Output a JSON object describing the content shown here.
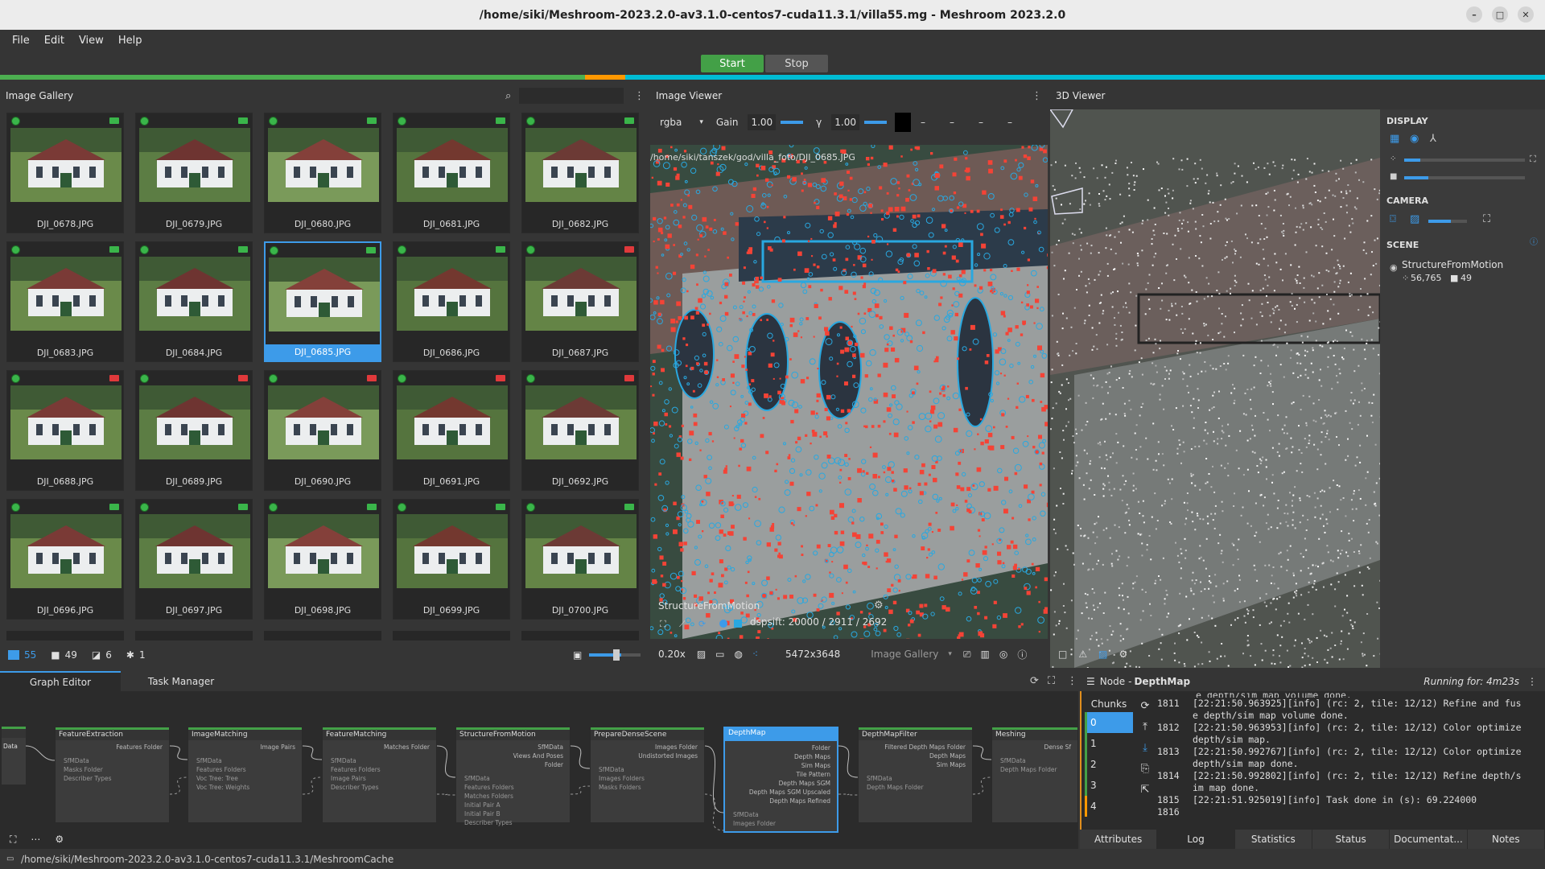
{
  "window": {
    "title": "/home/siki/Meshroom-2023.2.0-av3.1.0-centos7-cuda11.3.1/villa55.mg - Meshroom 2023.2.0"
  },
  "menu": [
    "File",
    "Edit",
    "View",
    "Help"
  ],
  "toolbar": {
    "start_label": "Start",
    "stop_label": "Stop"
  },
  "colors": {
    "accent": "#3d9be9",
    "start": "#43a047",
    "progress_green": "#4caf50",
    "progress_orange": "#ff9800",
    "progress_cyan": "#00bcd4",
    "features_red": "#f44336",
    "features_blue": "#29a8e0"
  },
  "gallery": {
    "title": "Image Gallery",
    "search_placeholder": "",
    "images": [
      {
        "name": "DJI_0678.JPG",
        "status": "ok",
        "cam": "green"
      },
      {
        "name": "DJI_0679.JPG",
        "status": "ok",
        "cam": "green"
      },
      {
        "name": "DJI_0680.JPG",
        "status": "ok",
        "cam": "green"
      },
      {
        "name": "DJI_0681.JPG",
        "status": "ok",
        "cam": "green"
      },
      {
        "name": "DJI_0682.JPG",
        "status": "ok",
        "cam": "green"
      },
      {
        "name": "DJI_0683.JPG",
        "status": "ok",
        "cam": "green"
      },
      {
        "name": "DJI_0684.JPG",
        "status": "ok",
        "cam": "green"
      },
      {
        "name": "DJI_0685.JPG",
        "status": "ok",
        "cam": "green",
        "selected": true
      },
      {
        "name": "DJI_0686.JPG",
        "status": "ok",
        "cam": "green"
      },
      {
        "name": "DJI_0687.JPG",
        "status": "ok",
        "cam": "red"
      },
      {
        "name": "DJI_0688.JPG",
        "status": "ok",
        "cam": "red"
      },
      {
        "name": "DJI_0689.JPG",
        "status": "ok",
        "cam": "red"
      },
      {
        "name": "DJI_0690.JPG",
        "status": "ok",
        "cam": "red"
      },
      {
        "name": "DJI_0691.JPG",
        "status": "ok",
        "cam": "red"
      },
      {
        "name": "DJI_0692.JPG",
        "status": "ok",
        "cam": "red"
      },
      {
        "name": "DJI_0696.JPG",
        "status": "ok",
        "cam": "green"
      },
      {
        "name": "DJI_0697.JPG",
        "status": "ok",
        "cam": "green"
      },
      {
        "name": "DJI_0698.JPG",
        "status": "ok",
        "cam": "green"
      },
      {
        "name": "DJI_0699.JPG",
        "status": "ok",
        "cam": "green"
      },
      {
        "name": "DJI_0700.JPG",
        "status": "ok",
        "cam": "green"
      }
    ],
    "footer": {
      "images": "55",
      "cameras": "49",
      "rejected": "6",
      "intrinsics": "1"
    }
  },
  "image_viewer": {
    "title": "Image Viewer",
    "channel": "rgba",
    "gain_label": "Gain",
    "gain_value": "1.00",
    "gamma_label": "γ",
    "gamma_value": "1.00",
    "dash_values": [
      "–",
      "–",
      "–",
      "–"
    ],
    "path": "/home/siki/tanszek/god/villa_foto/DJI_0685.JPG",
    "overlay_node": "StructureFromMotion",
    "overlay_stats": "dspsift: 20000 / 2911 / 2692",
    "zoom": "0.20x",
    "resolution": "5472x3648",
    "source": "Image Gallery"
  },
  "viewer3d": {
    "title": "3D Viewer",
    "display_label": "DISPLAY",
    "camera_label": "CAMERA",
    "scene_label": "SCENE",
    "scene_item": "StructureFromMotion",
    "points": "56,765",
    "cameras": "49"
  },
  "graph": {
    "tabs": [
      "Graph Editor",
      "Task Manager"
    ],
    "nodes": [
      {
        "title": "FeatureExtraction",
        "outputs": [
          "Features Folder"
        ],
        "inputs": [
          "SfMData",
          "Masks Folder",
          "Describer Types"
        ]
      },
      {
        "title": "ImageMatching",
        "outputs": [
          "Image Pairs"
        ],
        "inputs": [
          "SfMData",
          "Features Folders",
          "Voc Tree: Tree",
          "Voc Tree: Weights"
        ]
      },
      {
        "title": "FeatureMatching",
        "outputs": [
          "Matches Folder"
        ],
        "inputs": [
          "SfMData",
          "Features Folders",
          "Image Pairs",
          "Describer Types"
        ]
      },
      {
        "title": "StructureFromMotion",
        "outputs": [
          "SfMData",
          "Views And Poses",
          "Folder"
        ],
        "inputs": [
          "SfMData",
          "Features Folders",
          "Matches Folders",
          "Initial Pair A",
          "Initial Pair B",
          "Describer Types"
        ]
      },
      {
        "title": "PrepareDenseScene",
        "outputs": [
          "Images Folder",
          "Undistorted Images"
        ],
        "inputs": [
          "SfMData",
          "Images Folders",
          "Masks Folders"
        ]
      },
      {
        "title": "DepthMap",
        "outputs": [
          "Folder",
          "Depth Maps",
          "Sim Maps",
          "Tile Pattern",
          "Depth Maps SGM",
          "Depth Maps SGM Upscaled",
          "Depth Maps Refined"
        ],
        "inputs": [
          "SfMData",
          "Images Folder"
        ]
      },
      {
        "title": "DepthMapFilter",
        "outputs": [
          "Filtered Depth Maps Folder",
          "Depth Maps",
          "Sim Maps"
        ],
        "inputs": [
          "SfMData",
          "Depth Maps Folder"
        ]
      },
      {
        "title": "Meshing",
        "outputs": [
          "Dense Sf"
        ],
        "inputs": [
          "SfMData",
          "Depth Maps Folder"
        ]
      }
    ],
    "left_stub": "Data"
  },
  "node_panel": {
    "title": "Node",
    "node_name": "DepthMap",
    "running": "Running for: 4m23s",
    "chunks_label": "Chunks",
    "chunks": [
      "0",
      "1",
      "2",
      "3",
      "4"
    ],
    "log_partial": "e depth/sim map volume done.",
    "log": [
      {
        "line": "1811",
        "text": "[22:21:50.963925][info] (rc: 2, tile: 12/12) Refine and fus"
      },
      {
        "line": "",
        "text": "e depth/sim map volume done."
      },
      {
        "line": "1812",
        "text": "[22:21:50.963953][info] (rc: 2, tile: 12/12) Color optimize"
      },
      {
        "line": "",
        "text": "depth/sim map."
      },
      {
        "line": "1813",
        "text": "[22:21:50.992767][info] (rc: 2, tile: 12/12) Color optimize"
      },
      {
        "line": "",
        "text": "depth/sim map done."
      },
      {
        "line": "1814",
        "text": "[22:21:50.992802][info] (rc: 2, tile: 12/12) Refine depth/s"
      },
      {
        "line": "",
        "text": "im map done."
      },
      {
        "line": "1815",
        "text": "[22:21:51.925019][info] Task done in (s): 69.224000"
      },
      {
        "line": "1816",
        "text": ""
      }
    ],
    "tabs": [
      "Attributes",
      "Log",
      "Statistics",
      "Status",
      "Documentat...",
      "Notes"
    ]
  },
  "status": {
    "cache_path": "/home/siki/Meshroom-2023.2.0-av3.1.0-centos7-cuda11.3.1/MeshroomCache"
  }
}
